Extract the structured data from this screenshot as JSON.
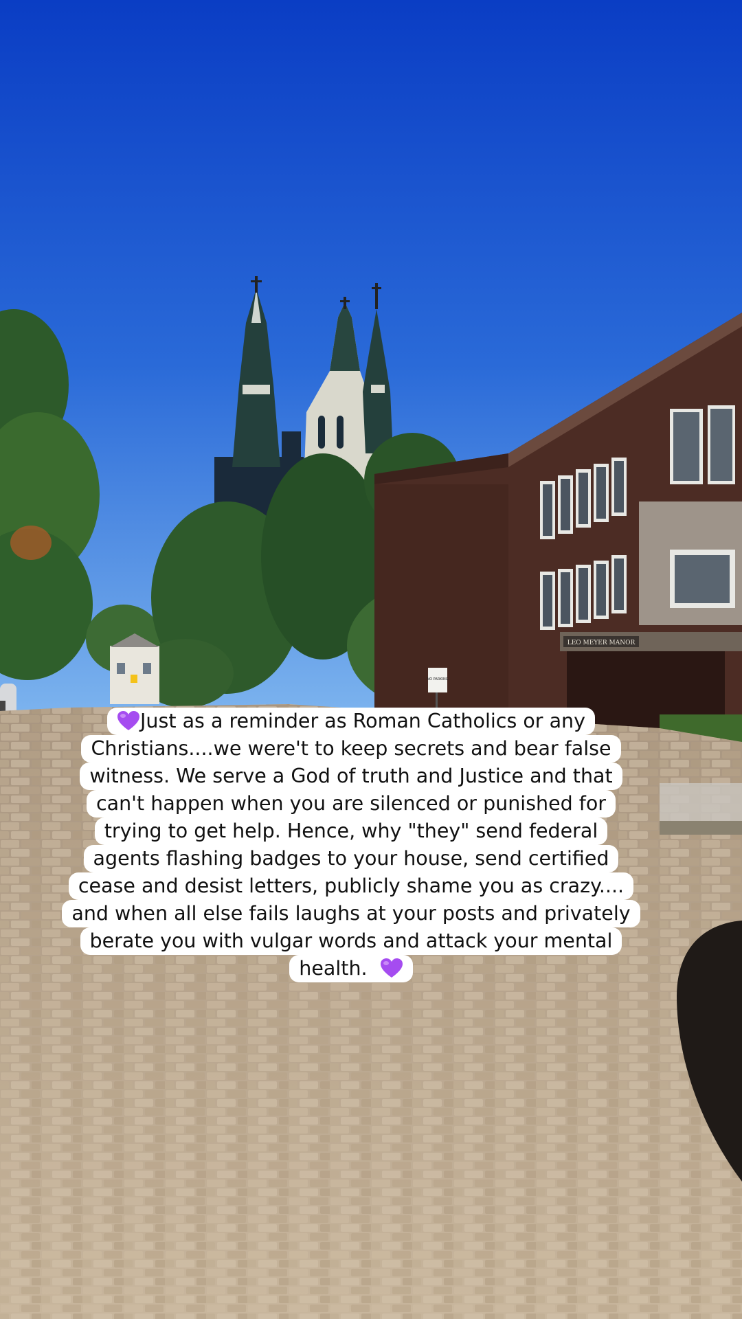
{
  "caption": {
    "lines": [
      "Just as a reminder as Roman Catholics or any",
      "Christians....we were't to keep secrets and bear false",
      "witness. We serve a God of truth and Justice and that",
      "can't happen when you are silenced or punished for",
      "trying to get help. Hence,  why \"they\" send federal",
      "agents flashing badges to your house, send certified",
      "cease and desist letters, publicly shame you as crazy....",
      "and when all else fails laughs at your posts and privately",
      "berate you with vulgar words and attack your mental",
      "health."
    ],
    "emoji": "purple-heart-icon",
    "accent": "#9b3ef0"
  },
  "scene": {
    "sign_building": "LEO MEYER MANOR",
    "sign_post": "NO PARKING",
    "colors": {
      "sky_top": "#0a3ec6",
      "sky_bottom": "#5ea3ee",
      "brick_building": "#4a2a22",
      "street": "#b9a58c"
    }
  }
}
